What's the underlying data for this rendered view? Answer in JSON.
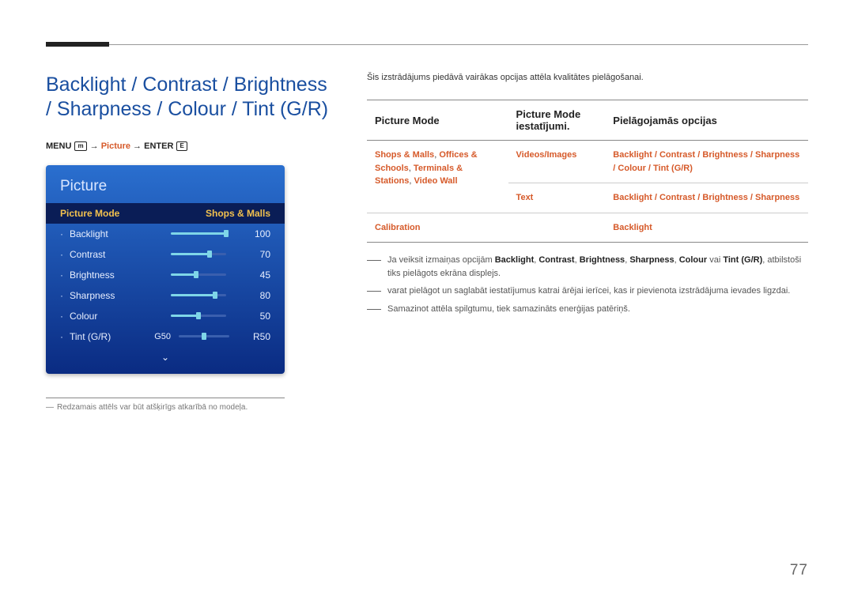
{
  "heading": "Backlight / Contrast / Brightness / Sharpness / Colour / Tint (G/R)",
  "menu_path": {
    "pre": "MENU ",
    "icon1": "m",
    "arrow1": " → ",
    "mid": "Picture",
    "arrow2": " → ",
    "post": "ENTER ",
    "icon2": "E"
  },
  "osd": {
    "title": "Picture",
    "mode_row": {
      "label": "Picture Mode",
      "value": "Shops & Malls"
    },
    "rows": [
      {
        "label": "Backlight",
        "value": "100",
        "pct": 100
      },
      {
        "label": "Contrast",
        "value": "70",
        "pct": 70
      },
      {
        "label": "Brightness",
        "value": "45",
        "pct": 45
      },
      {
        "label": "Sharpness",
        "value": "80",
        "pct": 80
      },
      {
        "label": "Colour",
        "value": "50",
        "pct": 50
      }
    ],
    "tint": {
      "label": "Tint (G/R)",
      "left": "G50",
      "right": "R50"
    }
  },
  "left_footnote_dash": "―",
  "left_footnote": "Redzamais attēls var būt atšķirīgs atkarībā no modeļa.",
  "intro": "Šis izstrādājums piedāvā vairākas opcijas attēla kvalitātes pielāgošanai.",
  "table": {
    "h1": "Picture Mode",
    "h2": "Picture Mode iestatījumi.",
    "h3": "Pielāgojamās opcijas",
    "rows": [
      {
        "c1a": "Shops & Malls",
        "c1b": "Offices & Schools",
        "c1c": "Terminals & Stations",
        "c1d": "Video Wall",
        "sep": ", ",
        "c2": "Videos/Images",
        "c3": "Backlight / Contrast / Brightness / Sharpness / Colour / Tint (G/R)"
      },
      {
        "c2": "Text",
        "c3": "Backlight / Contrast / Brightness / Sharpness"
      },
      {
        "c1": "Calibration",
        "c3": "Backlight"
      }
    ]
  },
  "notes": [
    {
      "pre": "Ja veiksit izmaiņas opcijām ",
      "b1": "Backlight",
      "s1": ", ",
      "b2": "Contrast",
      "s2": ", ",
      "b3": "Brightness",
      "s3": ", ",
      "b4": "Sharpness",
      "s4": ", ",
      "b5": "Colour",
      "s5": " vai ",
      "b6": "Tint (G/R)",
      "post": ", atbilstoši tiks pielāgots ekrāna displejs."
    },
    {
      "text": "varat pielāgot un saglabāt iestatījumus katrai ārējai ierīcei, kas ir pievienota izstrādājuma ievades ligzdai."
    },
    {
      "text": "Samazinot attēla spilgtumu, tiek samazināts enerģijas patēriņš."
    }
  ],
  "page": "77"
}
